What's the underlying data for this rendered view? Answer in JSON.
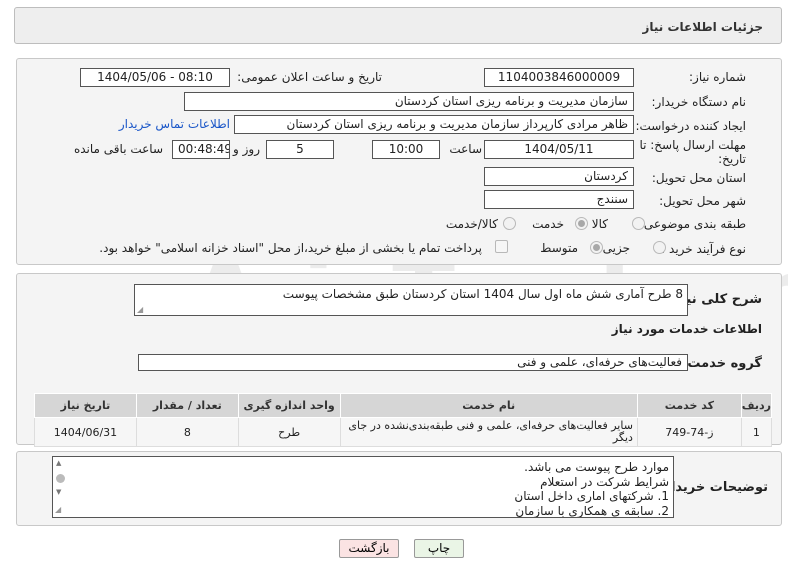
{
  "header": {
    "title": "جزئیات اطلاعات نیاز"
  },
  "form": {
    "need_number_label": "شماره نیاز:",
    "need_number": "1104003846000009",
    "announce_label": "تاریخ و ساعت اعلان عمومی:",
    "announce_value": "1404/05/06 - 08:10",
    "buyer_org_label": "نام دستگاه خریدار:",
    "buyer_org": "سازمان مدیریت و برنامه ریزی استان کردستان",
    "creator_label": "ایجاد کننده درخواست:",
    "creator": "ظاهر مرادی کارپرداز سازمان مدیریت و برنامه ریزی استان کردستان",
    "contact_link": "اطلاعات تماس خریدار",
    "deadline_label_1": "مهلت ارسال پاسخ: تا",
    "deadline_label_2": "تاریخ:",
    "deadline_date": "1404/05/11",
    "time_label": "ساعت",
    "deadline_time": "10:00",
    "days_value": "5",
    "days_label": "روز و",
    "remaining_time": "00:48:49",
    "remaining_label": "ساعت باقی مانده",
    "province_label": "استان محل تحویل:",
    "province": "کردستان",
    "city_label": "شهر محل تحویل:",
    "city": "سنندج",
    "category_label": "طبقه بندی موضوعی:",
    "category_options": [
      "کالا",
      "خدمت",
      "کالا/خدمت"
    ],
    "category_selected": "خدمت",
    "process_label": "نوع فرآیند خرید :",
    "process_options": [
      "جزیی",
      "متوسط"
    ],
    "process_selected": "متوسط",
    "payment_note": "پرداخت تمام یا بخشی از مبلغ خرید،از محل \"اسناد خزانه اسلامی\" خواهد بود."
  },
  "summary": {
    "label": "شرح کلی نیاز:",
    "text": "8 طرح آماری شش ماه اول سال 1404 استان کردستان طبق مشخصات پیوست"
  },
  "services": {
    "section_title": "اطلاعات خدمات مورد نیاز",
    "group_label": "گروه خدمت:",
    "group_value": "فعالیت‌های حرفه‌ای، علمی و فنی",
    "headers": [
      "ردیف",
      "کد خدمت",
      "نام خدمت",
      "واحد اندازه گیری",
      "تعداد / مقدار",
      "تاریخ نیاز"
    ],
    "rows": [
      {
        "row": "1",
        "code": "ز-74-749",
        "name": "سایر فعالیت‌های حرفه‌ای، علمی و فنی طبقه‌بندی‌نشده در جای دیگر",
        "unit": "طرح",
        "qty": "8",
        "date": "1404/06/31"
      }
    ]
  },
  "notes": {
    "label": "توضیحات خریدار:",
    "lines": [
      "موارد طرح پیوست می باشد.",
      "شرایط شرکت در استعلام",
      "1. شرکتهای اماری داخل استان",
      "2. سابقه ی همکاری با سازمان"
    ]
  },
  "buttons": {
    "print": "چاپ",
    "back": "بازگشت"
  },
  "colors": {
    "link": "#1a56c8",
    "back_button_bg": "#fbe3e3",
    "print_button_bg": "#eaf5e6"
  }
}
